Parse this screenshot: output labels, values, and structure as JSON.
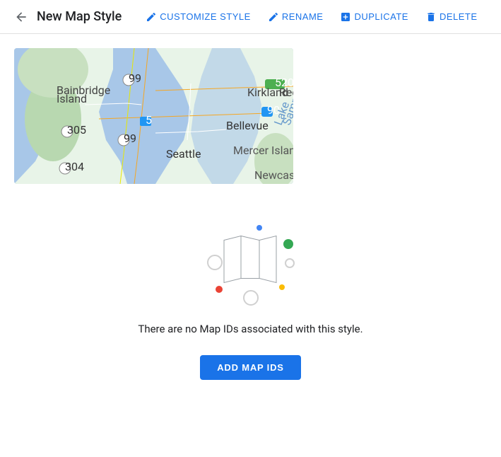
{
  "header": {
    "back_icon": "back-arrow",
    "title": "New Map Style",
    "actions": [
      {
        "id": "customize",
        "label": "CUSTOMIZE STYLE",
        "icon": "pencil-icon"
      },
      {
        "id": "rename",
        "label": "RENAME",
        "icon": "pencil-icon"
      },
      {
        "id": "duplicate",
        "label": "DUPLICATE",
        "icon": "duplicate-icon"
      },
      {
        "id": "delete",
        "label": "DELETE",
        "icon": "trash-icon"
      }
    ]
  },
  "empty_state": {
    "message": "There are no Map IDs associated with this style.",
    "add_button_label": "ADD MAP IDS"
  },
  "colors": {
    "primary": "#1a73e8",
    "dot_blue": "#4285F4",
    "dot_green": "#34A853",
    "dot_red": "#EA4335",
    "dot_yellow": "#FBBC04",
    "dot_light_blue": "#a8c7fa",
    "dot_light_red": "#f28b82",
    "dot_circle_outline": "#e0e0e0"
  }
}
